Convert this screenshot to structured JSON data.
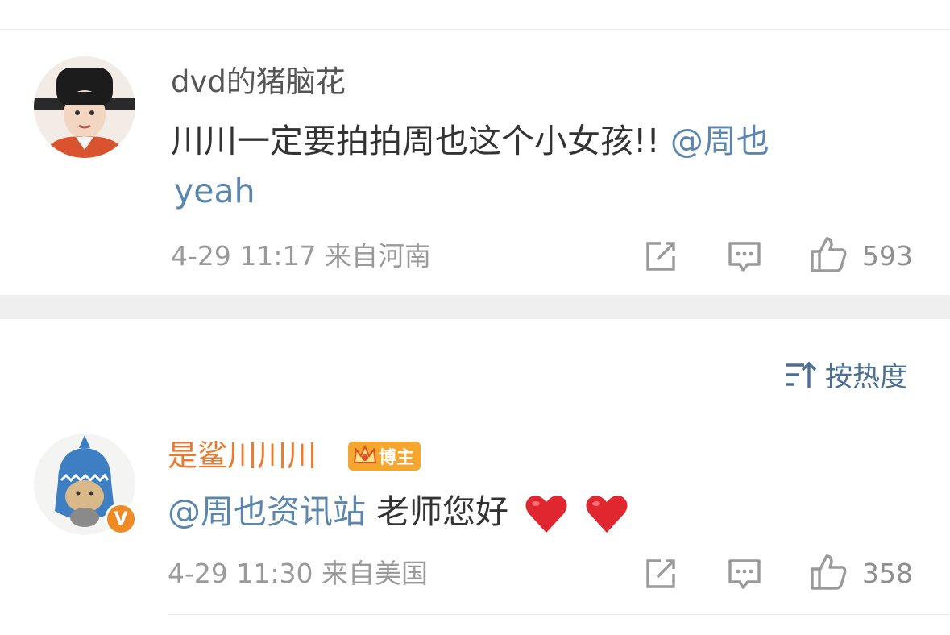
{
  "comments": [
    {
      "username": "dvd的猪脑花",
      "text": "川川一定要拍拍周也这个小女孩!!",
      "mention": "@周也",
      "text_line2": "yeah",
      "time": "4-29 11:17",
      "location": "来自河南",
      "likes": "593"
    },
    {
      "username": "是鲨川川川",
      "badge": "博主",
      "verified_mark": "V",
      "mention": "@周也资讯站",
      "text": "老师您好",
      "emoji": [
        "❤️",
        "❤️"
      ],
      "time": "4-29 11:30",
      "location": "来自美国",
      "likes": "358"
    }
  ],
  "sort": {
    "label": "按热度",
    "icon": "sort-icon"
  },
  "icons": {
    "repost": "share-icon",
    "comment": "comment-icon",
    "like": "thumbs-up-icon"
  },
  "colors": {
    "mention": "#5b86ad",
    "username_highlight": "#eb7a2e",
    "badge": "#f4a62f",
    "heart": "#e0262f"
  }
}
